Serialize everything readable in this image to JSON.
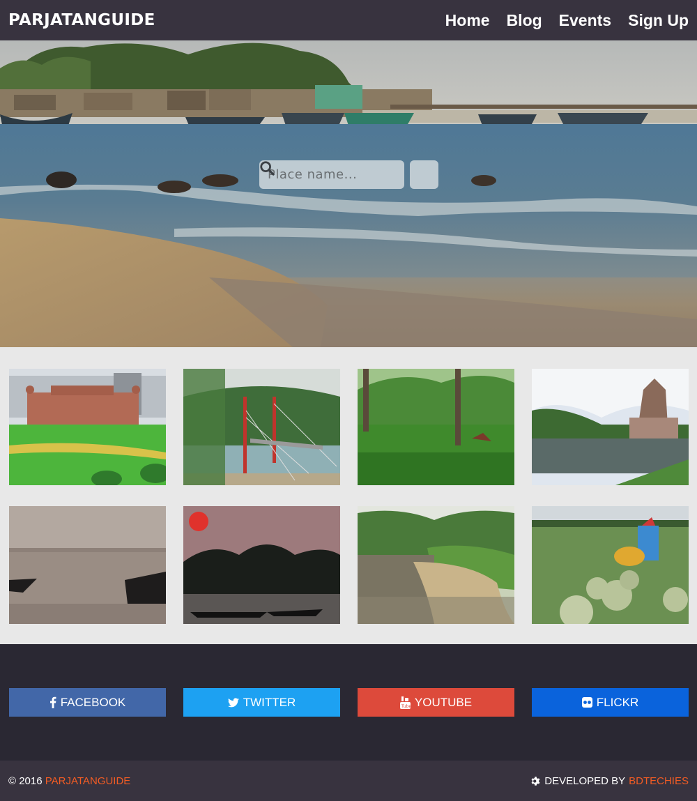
{
  "header": {
    "brand": "PARJATANGUIDE",
    "nav": [
      {
        "label": "Home"
      },
      {
        "label": "Blog"
      },
      {
        "label": "Events"
      },
      {
        "label": "Sign Up"
      }
    ]
  },
  "hero": {
    "search_placeholder": "Place name...",
    "search_icon": "search-icon"
  },
  "gallery": {
    "items": [
      {
        "icon": "fort-garden-photo"
      },
      {
        "icon": "hanging-bridge-photo"
      },
      {
        "icon": "tea-garden-photo"
      },
      {
        "icon": "temple-by-lake-photo"
      },
      {
        "icon": "misty-river-boats-photo"
      },
      {
        "icon": "sunset-river-boats-photo"
      },
      {
        "icon": "river-valley-photo"
      },
      {
        "icon": "pumpkin-farmer-photo"
      }
    ]
  },
  "social": [
    {
      "label": "FACEBOOK",
      "icon": "facebook-icon",
      "color": "#4267a8"
    },
    {
      "label": "TWITTER",
      "icon": "twitter-icon",
      "color": "#1da1f2"
    },
    {
      "label": "YOUTUBE",
      "icon": "youtube-icon",
      "color": "#dd4a3b"
    },
    {
      "label": "FLICKR",
      "icon": "flickr-icon",
      "color": "#0a63dc"
    }
  ],
  "footer": {
    "copyright_prefix": "© 2016",
    "copyright_brand": "PARJATANGUIDE",
    "developed_prefix": "DEVELOPED BY",
    "developer": "BDTECHIES"
  },
  "colors": {
    "navbar": "#38333f",
    "social_bg": "#2a2833",
    "accent": "#f25c24",
    "gallery_bg": "#e8e8e8"
  }
}
